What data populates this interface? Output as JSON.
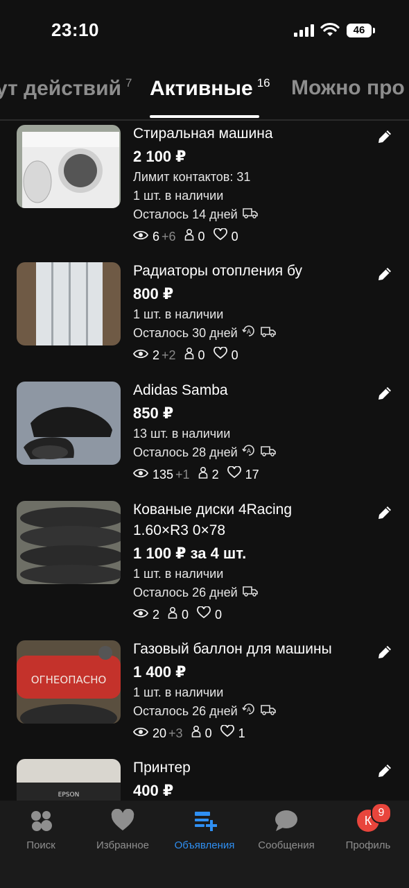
{
  "status": {
    "time": "23:10",
    "battery": "46"
  },
  "tabs": [
    {
      "label": "ут действий",
      "count": "7"
    },
    {
      "label": "Активные",
      "count": "16"
    },
    {
      "label": "Можно про",
      "count": ""
    }
  ],
  "listings": [
    {
      "title": "Стиральная машина",
      "price": "2 100 ₽",
      "extra": "Лимит контактов: 31",
      "stock": "1 шт. в наличии",
      "days": "Осталось 14 дней",
      "views": "6",
      "views_new": "+6",
      "contacts": "0",
      "favorites": "0",
      "image": "washing-machine"
    },
    {
      "title": "Радиаторы отопления бу",
      "price": "800 ₽",
      "stock": "1 шт. в наличии",
      "days": "Осталось 30 дней",
      "views": "2",
      "views_new": "+2",
      "contacts": "0",
      "favorites": "0",
      "image": "radiators"
    },
    {
      "title": "Adidas Samba",
      "price": "850 ₽",
      "stock": "13 шт. в наличии",
      "days": "Осталось 28 дней",
      "views": "135",
      "views_new": "+1",
      "contacts": "2",
      "favorites": "17",
      "image": "sneakers"
    },
    {
      "title": "Кованые диски 4Racing",
      "title2": "1.60×R3 0×78",
      "price": "1 100 ₽ за 4 шт.",
      "stock": "1 шт. в наличии",
      "days": "Осталось 26 дней",
      "views": "2",
      "views_new": "",
      "contacts": "0",
      "favorites": "0",
      "image": "tires"
    },
    {
      "title": "Газовый баллон для машины",
      "price": "1 400 ₽",
      "stock": "1 шт. в наличии",
      "days": "Осталось 26 дней",
      "views": "20",
      "views_new": "+3",
      "contacts": "0",
      "favorites": "1",
      "image": "gas-cylinder",
      "image_text": "ОГНЕОПАСНО"
    },
    {
      "title": "Принтер",
      "price": "400 ₽",
      "image": "printer",
      "image_text": "EPSON"
    }
  ],
  "nav": [
    {
      "label": "Поиск",
      "icon": "search-dots-icon"
    },
    {
      "label": "Избранное",
      "icon": "heart-icon"
    },
    {
      "label": "Объявления",
      "icon": "listings-icon"
    },
    {
      "label": "Сообщения",
      "icon": "chat-icon"
    },
    {
      "label": "Профиль",
      "avatar": "К",
      "badge": "9"
    }
  ],
  "colors": {
    "background": "#111111",
    "accent": "#2f8ff2",
    "badge": "#e8453c",
    "muted": "#8f8f8f"
  }
}
